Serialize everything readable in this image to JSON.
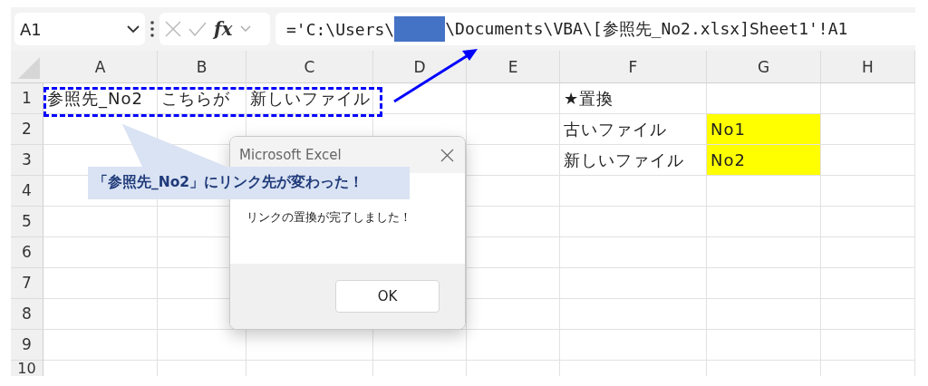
{
  "name_box": {
    "value": "A1"
  },
  "formula_bar": {
    "function_label": "fx",
    "formula_before_redaction": "='C:\\Users\\",
    "formula_after_redaction": "\\Documents\\VBA\\[参照先_No2.xlsx]Sheet1'!A1"
  },
  "columns": [
    "A",
    "B",
    "C",
    "D",
    "E",
    "F",
    "G",
    "H"
  ],
  "rows": [
    {
      "number": "1",
      "cells": [
        {
          "text": "参照先_No2",
          "highlighted": false
        },
        {
          "text": "こちらが",
          "highlighted": false
        },
        {
          "text": "新しいファイル",
          "highlighted": false
        },
        null,
        null,
        {
          "text": "★置換",
          "highlighted": false
        },
        null,
        null
      ]
    },
    {
      "number": "2",
      "cells": [
        null,
        null,
        null,
        null,
        null,
        {
          "text": "古いファイル",
          "highlighted": false
        },
        {
          "text": "No1",
          "highlighted": true
        },
        null
      ]
    },
    {
      "number": "3",
      "cells": [
        null,
        null,
        null,
        null,
        null,
        {
          "text": "新しいファイル",
          "highlighted": false
        },
        {
          "text": "No2",
          "highlighted": true
        },
        null
      ]
    },
    {
      "number": "4",
      "cells": [
        null,
        null,
        null,
        null,
        null,
        null,
        null,
        null
      ]
    },
    {
      "number": "5",
      "cells": [
        null,
        null,
        null,
        null,
        null,
        null,
        null,
        null
      ]
    },
    {
      "number": "6",
      "cells": [
        null,
        null,
        null,
        null,
        null,
        null,
        null,
        null
      ]
    },
    {
      "number": "7",
      "cells": [
        null,
        null,
        null,
        null,
        null,
        null,
        null,
        null
      ]
    },
    {
      "number": "8",
      "cells": [
        null,
        null,
        null,
        null,
        null,
        null,
        null,
        null
      ]
    },
    {
      "number": "9",
      "cells": [
        null,
        null,
        null,
        null,
        null,
        null,
        null,
        null
      ]
    },
    {
      "number": "10",
      "cells": [
        null,
        null,
        null,
        null,
        null,
        null,
        null,
        null
      ]
    }
  ],
  "callout": {
    "text": "「参照先_No2」にリンク先が変わった！"
  },
  "dialog": {
    "title": "Microsoft Excel",
    "message": "リンクの置換が完了しました！",
    "button": "OK"
  }
}
